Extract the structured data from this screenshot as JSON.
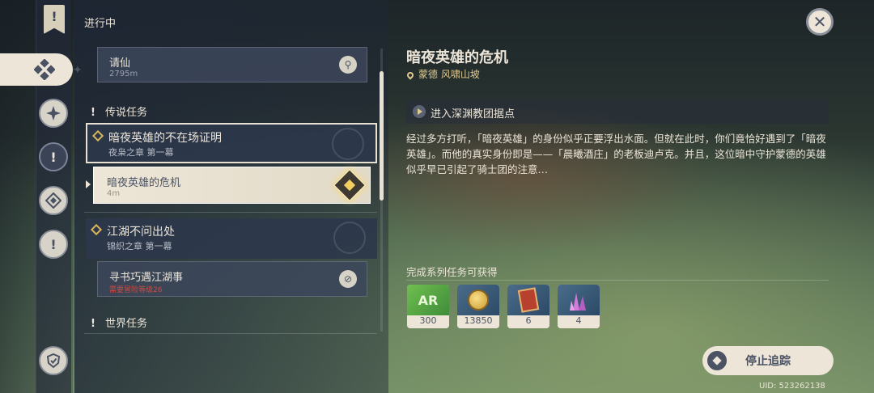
{
  "header": {
    "title": "进行中"
  },
  "quests": {
    "top_sub": {
      "name": "请仙",
      "distance": "2795m"
    },
    "legend_section": "传说任务",
    "legend_card1": {
      "name": "暗夜英雄的不在场证明",
      "chapter": "夜枭之章 第一幕"
    },
    "tracked_sub": {
      "name": "暗夜英雄的危机",
      "distance": "4m"
    },
    "legend_card2": {
      "name": "江湖不问出处",
      "chapter": "锦织之章 第一幕"
    },
    "locked_sub": {
      "name": "寻书巧遇江湖事",
      "requirement": "需要冒险等级26"
    },
    "world_section": "世界任务"
  },
  "detail": {
    "title": "暗夜英雄的危机",
    "location": "蒙德 风啸山坡",
    "objective": "进入深渊教团据点",
    "description": "经过多方打听，「暗夜英雄」的身份似乎正要浮出水面。但就在此时，你们竟恰好遇到了「暗夜英雄」。而他的真实身份即是——「晨曦酒庄」的老板迪卢克。并且，这位暗中守护蒙德的英雄似乎早已引起了骑士团的注意…",
    "rewards_label": "完成系列任务可获得",
    "rewards": [
      {
        "icon": "adventure-exp-icon",
        "count": "300"
      },
      {
        "icon": "mora-coin-icon",
        "count": "13850"
      },
      {
        "icon": "hero-wit-book-icon",
        "count": "6"
      },
      {
        "icon": "crystal-ore-icon",
        "count": "4"
      }
    ]
  },
  "stop_button": "停止追踪",
  "uid": "UID: 523262138",
  "colors": {
    "parchment": "#ece5d8",
    "slate": "#4a5263",
    "gold": "#d8b35b",
    "panel": "#2d374b"
  }
}
